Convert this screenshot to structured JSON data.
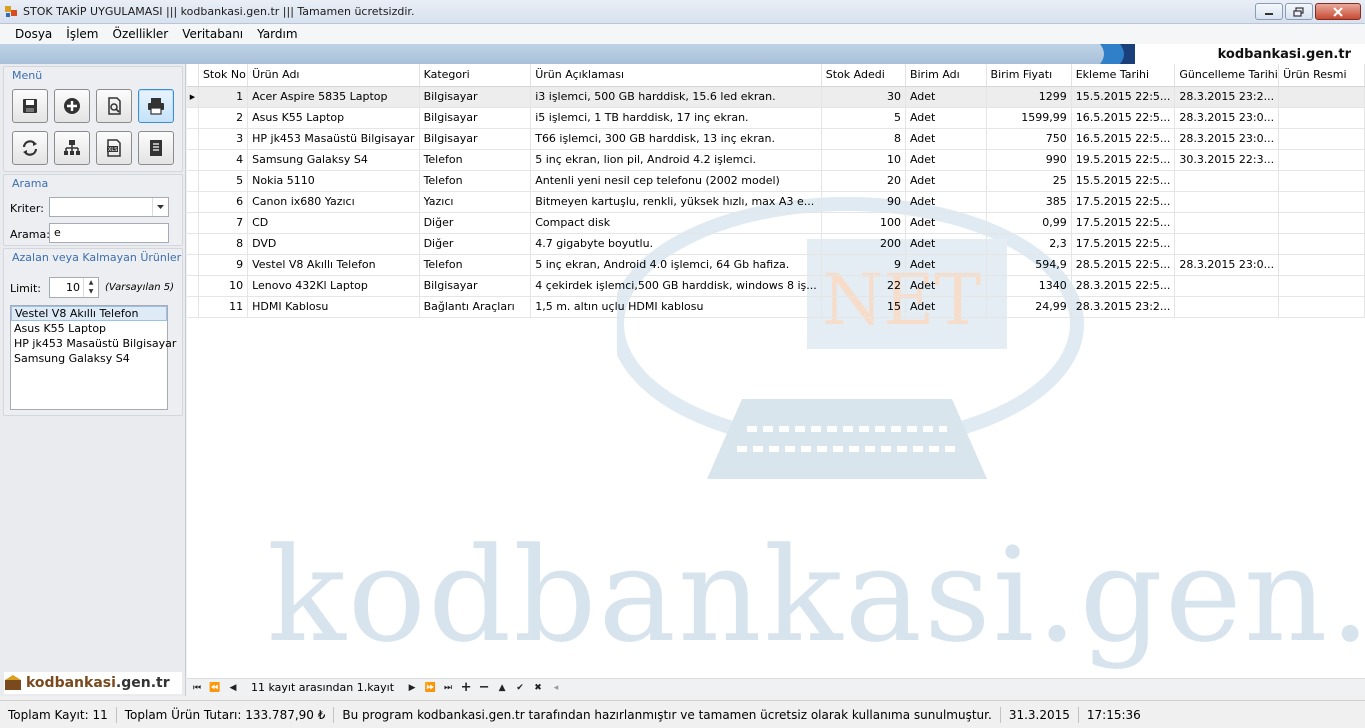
{
  "window": {
    "title": "STOK TAKİP UYGULAMASI ||| kodbankasi.gen.tr ||| Tamamen ücretsizdir."
  },
  "menu": [
    "Dosya",
    "İşlem",
    "Özellikler",
    "Veritabanı",
    "Yardım"
  ],
  "banner": {
    "brand": "kodbankasi.gen.tr"
  },
  "sidebar": {
    "menu_title": "Menü",
    "toolbar_icons": [
      "save-icon",
      "add-icon",
      "search-doc-icon",
      "print-icon",
      "refresh-icon",
      "network-icon",
      "excel-icon",
      "report-icon"
    ],
    "search_title": "Arama",
    "criteria_label": "Kriter:",
    "criteria_value": "",
    "search_label": "Arama:",
    "search_value": "e",
    "low_stock_title": "Azalan veya Kalmayan Ürünler",
    "limit_label": "Limit:",
    "limit_value": "10",
    "limit_hint": "(Varsayılan 5)",
    "low_stock_items": [
      "Vestel V8 Akıllı Telefon",
      "Asus K55 Laptop",
      "HP jk453 Masaüstü Bilgisayar",
      "Samsung Galaksy S4"
    ],
    "logo_left": "kodbankasi",
    "logo_right": ".gen.tr"
  },
  "grid": {
    "columns": [
      "Stok No",
      "Ürün Adı",
      "Kategori",
      "Ürün Açıklaması",
      "Stok Adedi",
      "Birim Adı",
      "Birim Fiyatı",
      "Ekleme Tarihi",
      "Güncelleme Tarihi",
      "Ürün Resmi"
    ],
    "current_row_marker": "▶",
    "rows": [
      [
        "1",
        "Acer Aspire 5835 Laptop",
        "Bilgisayar",
        "i3 işlemci, 500 GB harddisk, 15.6 led ekran.",
        "30",
        "Adet",
        "1299",
        "15.5.2015 22:5...",
        "28.3.2015 23:2...",
        ""
      ],
      [
        "2",
        "Asus K55 Laptop",
        "Bilgisayar",
        "i5 işlemci, 1 TB harddisk, 17 inç ekran.",
        "5",
        "Adet",
        "1599,99",
        "16.5.2015 22:5...",
        "28.3.2015 23:0...",
        ""
      ],
      [
        "3",
        "HP jk453 Masaüstü Bilgisayar",
        "Bilgisayar",
        "T66 işlemci, 300 GB harddisk, 13 inç ekran.",
        "8",
        "Adet",
        "750",
        "16.5.2015 22:5...",
        "28.3.2015 23:0...",
        ""
      ],
      [
        "4",
        "Samsung Galaksy S4",
        "Telefon",
        "5 inç ekran, lion pil, Android 4.2 işlemci.",
        "10",
        "Adet",
        "990",
        "19.5.2015 22:5...",
        "30.3.2015 22:3...",
        ""
      ],
      [
        "5",
        "Nokia 5110",
        "Telefon",
        "Antenli yeni nesil cep telefonu (2002 model)",
        "20",
        "Adet",
        "25",
        "15.5.2015 22:5...",
        "",
        ""
      ],
      [
        "6",
        "Canon ix680 Yazıcı",
        "Yazıcı",
        "Bitmeyen kartuşlu, renkli, yüksek hızlı, max A3 e...",
        "90",
        "Adet",
        "385",
        "17.5.2015 22:5...",
        "",
        ""
      ],
      [
        "7",
        "CD",
        "Diğer",
        "Compact disk",
        "100",
        "Adet",
        "0,99",
        "17.5.2015 22:5...",
        "",
        ""
      ],
      [
        "8",
        "DVD",
        "Diğer",
        "4.7 gigabyte boyutlu.",
        "200",
        "Adet",
        "2,3",
        "17.5.2015 22:5...",
        "",
        ""
      ],
      [
        "9",
        "Vestel V8 Akıllı Telefon",
        "Telefon",
        "5 inç ekran, Android 4.0 işlemci, 64 Gb hafiza.",
        "9",
        "Adet",
        "594,9",
        "28.5.2015 22:5...",
        "28.3.2015 23:0...",
        ""
      ],
      [
        "10",
        "Lenovo 432Kl Laptop",
        "Bilgisayar",
        "4 çekirdek işlemci,500 GB harddisk, windows 8 iş...",
        "22",
        "Adet",
        "1340",
        "28.3.2015 22:5...",
        "",
        ""
      ],
      [
        "11",
        "HDMI Kablosu",
        "Bağlantı Araçları",
        "1,5 m. altın uçlu HDMI kablosu",
        "15",
        "Adet",
        "24,99",
        "28.3.2015 23:2...",
        "",
        ""
      ]
    ]
  },
  "watermark": {
    "text": "kodbankasi.gen.tr",
    "logo_text": "NET"
  },
  "navigator": {
    "position_text": "11 kayıt arasından 1.kayıt"
  },
  "status": {
    "total_records": "Toplam Kayıt: 11",
    "total_amount": "Toplam Ürün Tutarı: 133.787,90 ₺",
    "info": "Bu program kodbankasi.gen.tr tarafından hazırlanmıştır ve tamamen ücretsiz olarak kullanıma sunulmuştur.",
    "date": "31.3.2015",
    "time": "17:15:36"
  },
  "colors": {
    "accent": "#3b6fae",
    "banner": "#a7c0da",
    "watermark": "#d7e4ee"
  }
}
